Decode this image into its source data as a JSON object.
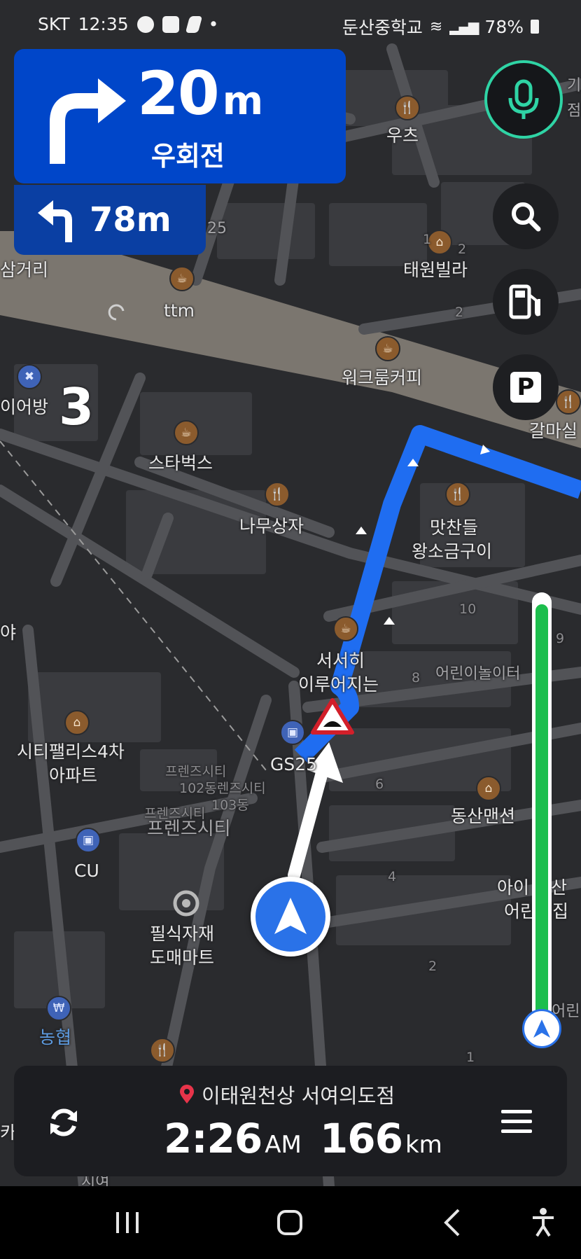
{
  "status_bar": {
    "carrier": "SKT",
    "time": "12:35",
    "dot": "•",
    "location": "둔산중학교",
    "battery": "78%"
  },
  "turn_card": {
    "distance_value": "20",
    "distance_unit": "m",
    "street": "우회전",
    "icon": "turn-right-arrow"
  },
  "next_turn": {
    "distance": "78m",
    "icon": "turn-left-arrow"
  },
  "map": {
    "labels": {
      "utz": "우츠",
      "taewon_villa": "태원빌라",
      "samgeori": "삼거리",
      "ttm": "ttm",
      "workroom_coffee": "워크룸커피",
      "galmasil": "갈마실",
      "ieobang": "이어방",
      "starbucks": "스타벅스",
      "namu_sangja": "나무상자",
      "matchandeul_1": "맛찬들",
      "matchandeul_2": "왕소금구이",
      "aya": "야",
      "seoseohi_1": "서서히",
      "seoseohi_2": "이루어지는",
      "kids_playground": "어린이놀이터",
      "city_palace_1": "시티팰리스4차",
      "city_palace_2": "아파트",
      "gs25": "GS25",
      "friends_city_a": "프렌즈시티",
      "friends_city_b": "102동렌즈시티",
      "friends_city_c": "103동",
      "friends_city_d": "프렌즈시티",
      "friends_city_e": "프렌즈시티",
      "dongsan_mansion": "동산맨션",
      "cu": "CU",
      "daycare_1": "아이 동산",
      "daycare_2": "어린이집",
      "pilsik_1": "필식자재",
      "pilsik_2": "도매마트",
      "nonghyup": "농협",
      "eorin": "어린",
      "bldg_25": "25",
      "bldg_1": "1",
      "bldg_2a": "2",
      "bldg_2b": "2",
      "bldg_10": "10",
      "bldg_8": "8",
      "bldg_6": "6",
      "bldg_4": "4",
      "bldg_2c": "2",
      "bldg_9": "9",
      "bldg_1b": "1",
      "region_number": "3",
      "partial_top": "기",
      "partial_top2": "점",
      "partial_left": "카",
      "partial_bottom": "시여"
    }
  },
  "route": {
    "progress_fraction": 0.98
  },
  "bottom_panel": {
    "destination": "이태원천상 서여의도점",
    "eta_time": "2:26",
    "eta_ampm": "AM",
    "remaining_distance": "166",
    "remaining_unit": "km"
  },
  "colors": {
    "turn_card": "#0046c9",
    "route": "#1f6df1",
    "progress": "#1cbe4d",
    "mic_ring": "#2fd4a5"
  }
}
